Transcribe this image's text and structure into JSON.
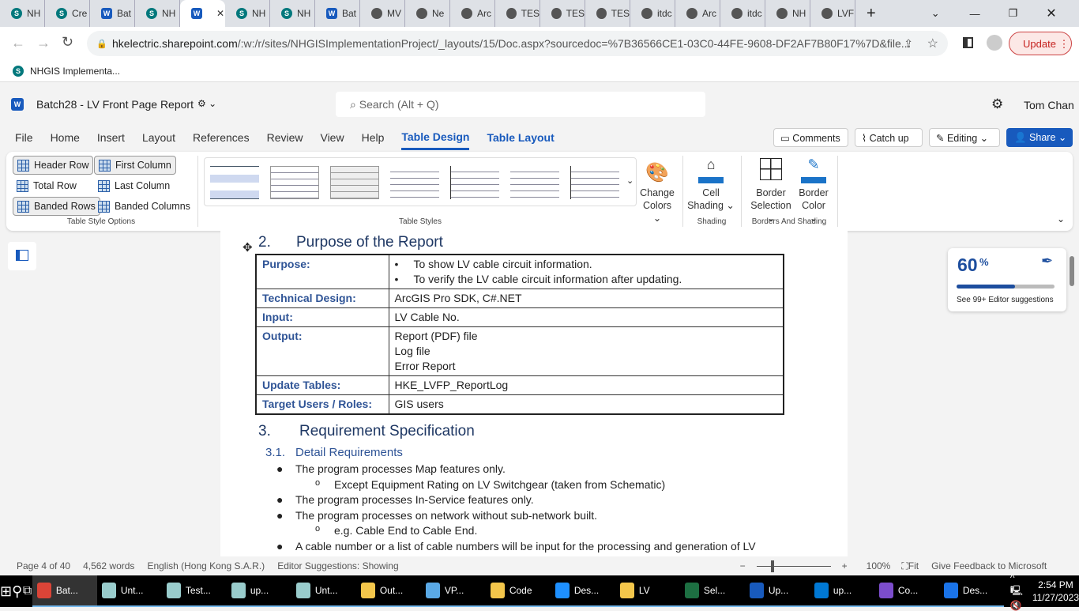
{
  "browser": {
    "tabs": [
      {
        "icon": "S",
        "t": "s",
        "label": "NH"
      },
      {
        "icon": "S",
        "t": "s",
        "label": "Cre"
      },
      {
        "icon": "W",
        "t": "w",
        "label": "Bat"
      },
      {
        "icon": "S",
        "t": "s",
        "label": "NH"
      },
      {
        "icon": "W",
        "t": "w",
        "label": "",
        "active": true
      },
      {
        "icon": "S",
        "t": "s",
        "label": "NH"
      },
      {
        "icon": "S",
        "t": "s",
        "label": "NH"
      },
      {
        "icon": "W",
        "t": "w",
        "label": "Bat"
      },
      {
        "icon": "",
        "t": "g",
        "label": "MV"
      },
      {
        "icon": "",
        "t": "g",
        "label": "Ne"
      },
      {
        "icon": "",
        "t": "g",
        "label": "Arc"
      },
      {
        "icon": "",
        "t": "g",
        "label": "TES"
      },
      {
        "icon": "",
        "t": "g",
        "label": "TES"
      },
      {
        "icon": "",
        "t": "g",
        "label": "TES"
      },
      {
        "icon": "",
        "t": "g",
        "label": "itdc"
      },
      {
        "icon": "",
        "t": "g",
        "label": "Arc"
      },
      {
        "icon": "",
        "t": "g",
        "label": "itdc"
      },
      {
        "icon": "",
        "t": "g",
        "label": "NH"
      },
      {
        "icon": "",
        "t": "g",
        "label": "LVF"
      }
    ],
    "url_host": "hkelectric.sharepoint.com",
    "url_rest": "/:w:/r/sites/NHGISImplementationProject/_layouts/15/Doc.aspx?sourcedoc=%7B36566CE1-03C0-44FE-9608-DF2AF7B80F17%7D&file...",
    "update_label": "Update",
    "bookmark": "NHGIS Implementa..."
  },
  "word": {
    "title": "Batch28 - LV Front Page Report",
    "search_placeholder": "Search (Alt + Q)",
    "user": "Tom Chan",
    "menu": [
      "File",
      "Home",
      "Insert",
      "Layout",
      "References",
      "Review",
      "View",
      "Help",
      "Table Design",
      "Table Layout"
    ],
    "selected_menu": "Table Design",
    "actions": {
      "comments": "Comments",
      "catchup": "Catch up",
      "editing": "Editing",
      "share": "Share"
    }
  },
  "ribbon": {
    "options": {
      "header_row": "Header Row",
      "first_column": "First Column",
      "total_row": "Total Row",
      "last_column": "Last Column",
      "banded_rows": "Banded Rows",
      "banded_columns": "Banded Columns",
      "group": "Table Style Options"
    },
    "styles_group": "Table Styles",
    "change_colors": [
      "Change",
      "Colors"
    ],
    "cell_shading": [
      "Cell",
      "Shading"
    ],
    "shading_group": "Shading",
    "border_selection": [
      "Border",
      "Selection"
    ],
    "border_color": [
      "Border",
      "Color"
    ],
    "borders_group": "Borders And Shading"
  },
  "document": {
    "heading2": {
      "num": "2.",
      "text": "Purpose of the Report"
    },
    "table": [
      {
        "k": "Purpose:",
        "v": [
          "To show LV cable circuit information.",
          "To verify the LV cable circuit information after updating."
        ],
        "bullets": true
      },
      {
        "k": "Technical Design:",
        "v": [
          "ArcGIS Pro SDK, C#.NET"
        ]
      },
      {
        "k": "Input:",
        "v": [
          "LV Cable No."
        ]
      },
      {
        "k": "Output:",
        "v": [
          "Report (PDF) file",
          "Log file",
          "Error Report"
        ]
      },
      {
        "k": "Update Tables:",
        "v": [
          "HKE_LVFP_ReportLog"
        ]
      },
      {
        "k": "Target Users / Roles:",
        "v": [
          "GIS users"
        ]
      }
    ],
    "heading3": {
      "num": "3.",
      "text": "Requirement Specification"
    },
    "heading31": {
      "num": "3.1.",
      "text": "Detail Requirements"
    },
    "bullets": [
      {
        "l": 1,
        "t": "The program processes Map features only."
      },
      {
        "l": 2,
        "t": "Except Equipment Rating on LV Switchgear (taken from Schematic)"
      },
      {
        "l": 1,
        "t": "The program processes In-Service features only."
      },
      {
        "l": 1,
        "t": "The program processes on network without sub-network built."
      },
      {
        "l": 2,
        "t": "e.g. Cable End to Cable End."
      },
      {
        "l": 1,
        "t": "A cable number or a list of cable numbers will be input for the processing and generation of LV"
      }
    ]
  },
  "editor": {
    "score": "60",
    "pct": "%",
    "progress": 0.6,
    "suggestions": "See 99+ Editor suggestions"
  },
  "status": {
    "page": "Page 4 of 40",
    "words": "4,562 words",
    "lang": "English (Hong Kong S.A.R.)",
    "editor": "Editor Suggestions: Showing",
    "zoom": "100%",
    "fit": "Fit",
    "feedback": "Give Feedback to Microsoft"
  },
  "taskbar": {
    "items": [
      {
        "l": "Bat...",
        "c": "#db4437"
      },
      {
        "l": "Unt...",
        "c": "#9cc"
      },
      {
        "l": "Test...",
        "c": "#9cc"
      },
      {
        "l": "up...",
        "c": "#9cc"
      },
      {
        "l": "Unt...",
        "c": "#9cc"
      },
      {
        "l": "Out...",
        "c": "#f3c64b"
      },
      {
        "l": "VP...",
        "c": "#5aa9e6"
      },
      {
        "l": "Code",
        "c": "#f3c64b"
      },
      {
        "l": "Des...",
        "c": "#1e90ff"
      },
      {
        "l": "LV",
        "c": "#f3c64b"
      },
      {
        "l": "Sel...",
        "c": "#1d6f42"
      },
      {
        "l": "Up...",
        "c": "#185abd"
      },
      {
        "l": "up...",
        "c": "#0078d4"
      },
      {
        "l": "Co...",
        "c": "#7c4dcc"
      },
      {
        "l": "Des...",
        "c": "#1a73e8"
      }
    ],
    "time": "2:54 PM",
    "date": "11/27/2023"
  }
}
